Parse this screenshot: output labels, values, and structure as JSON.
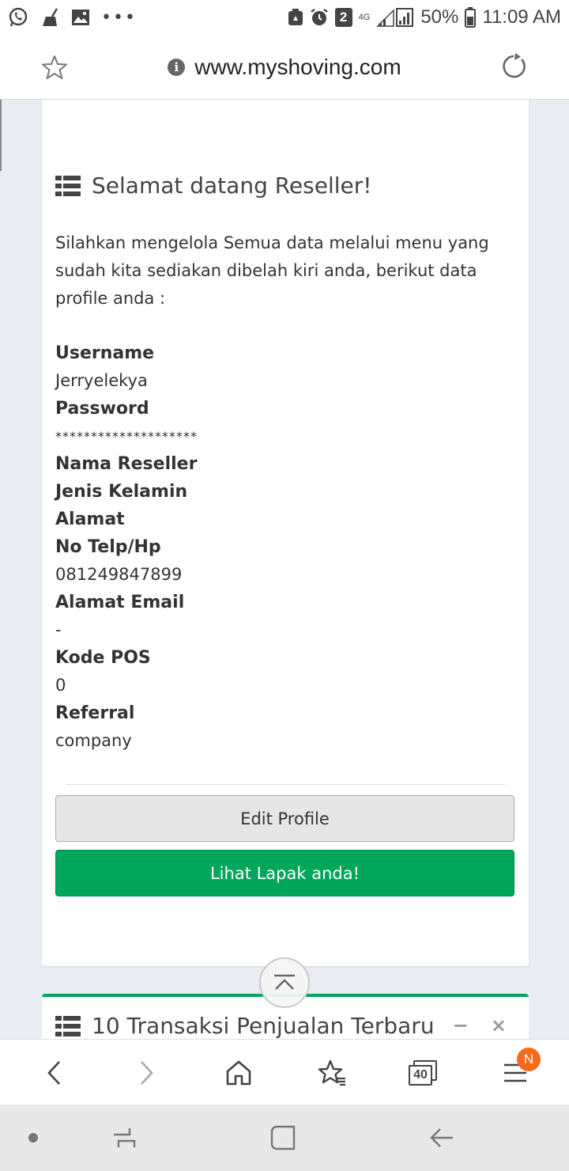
{
  "status_bar": {
    "battery_percent": "50%",
    "time": "11:09 AM",
    "notification_count": "2",
    "network": "4G"
  },
  "url_bar": {
    "url": "www.myshoving.com"
  },
  "profile_card": {
    "title": "Selamat datang Reseller!",
    "intro": "Silahkan mengelola Semua data melalui menu yang sudah kita sediakan dibelah kiri anda, berikut data profile anda :",
    "fields": {
      "username_label": "Username",
      "username_value": "Jerryelekya",
      "password_label": "Password",
      "password_value": "********************",
      "nama_reseller_label": "Nama Reseller",
      "jenis_kelamin_label": "Jenis Kelamin",
      "alamat_label": "Alamat",
      "no_telp_label": "No Telp/Hp",
      "no_telp_value": "081249847899",
      "alamat_email_label": "Alamat Email",
      "alamat_email_value": "-",
      "kode_pos_label": "Kode POS",
      "kode_pos_value": "0",
      "referral_label": "Referral",
      "referral_value": "company"
    },
    "edit_button": "Edit Profile",
    "lapak_button": "Lihat Lapak anda!"
  },
  "transactions_card": {
    "title": "10 Transaksi Penjualan Terbaru",
    "minimize": "−",
    "close": "×"
  },
  "bottom_toolbar": {
    "tab_count": "40",
    "menu_badge": "N"
  },
  "colors": {
    "accent_green": "#00a65a",
    "badge_orange": "#f26c1b",
    "page_bg": "#e9edf3"
  }
}
